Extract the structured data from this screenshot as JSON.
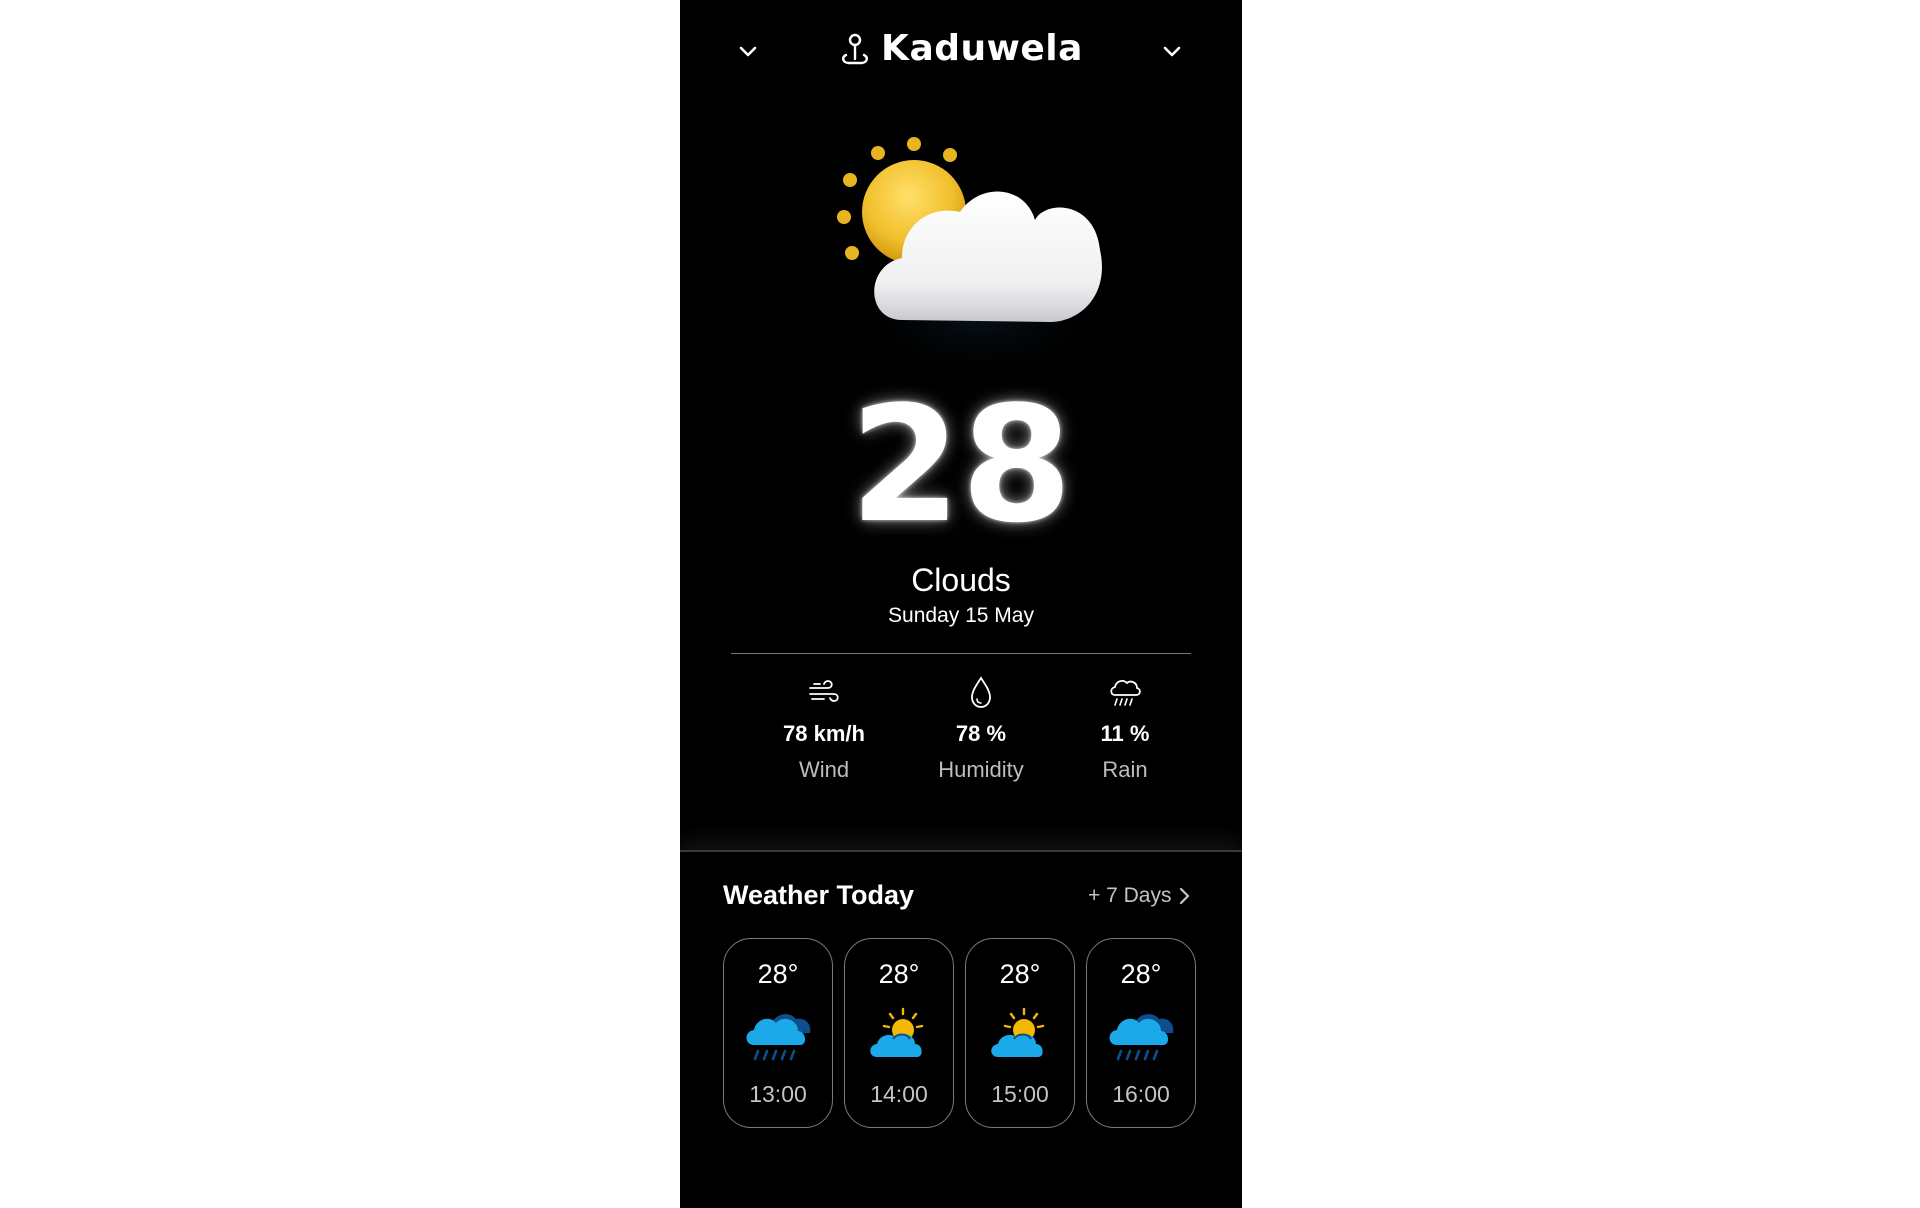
{
  "header": {
    "location": "Kaduwela",
    "left_icon": "chevron-down-icon",
    "right_icon": "chevron-down-icon",
    "pin_icon": "location-pin-icon"
  },
  "current": {
    "icon": "sun-behind-cloud-icon",
    "temperature": "28",
    "condition": "Clouds",
    "date": "Sunday 15 May"
  },
  "stats": {
    "wind": {
      "value": "78 km/h",
      "label": "Wind",
      "icon": "wind-icon"
    },
    "humidity": {
      "value": "78 %",
      "label": "Humidity",
      "icon": "droplet-icon"
    },
    "rain": {
      "value": "11 %",
      "label": "Rain",
      "icon": "rain-cloud-icon"
    }
  },
  "today": {
    "title": "Weather Today",
    "more_label": "+ 7 Days",
    "hours": [
      {
        "temp": "28°",
        "time": "13:00",
        "icon": "rain-cloud-icon"
      },
      {
        "temp": "28°",
        "time": "14:00",
        "icon": "partly-sunny-icon"
      },
      {
        "temp": "28°",
        "time": "15:00",
        "icon": "partly-sunny-icon"
      },
      {
        "temp": "28°",
        "time": "16:00",
        "icon": "rain-cloud-icon"
      }
    ]
  },
  "colors": {
    "background": "#000000",
    "text": "#ffffff",
    "muted_text": "#bdbdbd",
    "sun": "#e8b520",
    "rain_cloud": "#1ba9ea",
    "card_border": "#7a7a7a"
  }
}
